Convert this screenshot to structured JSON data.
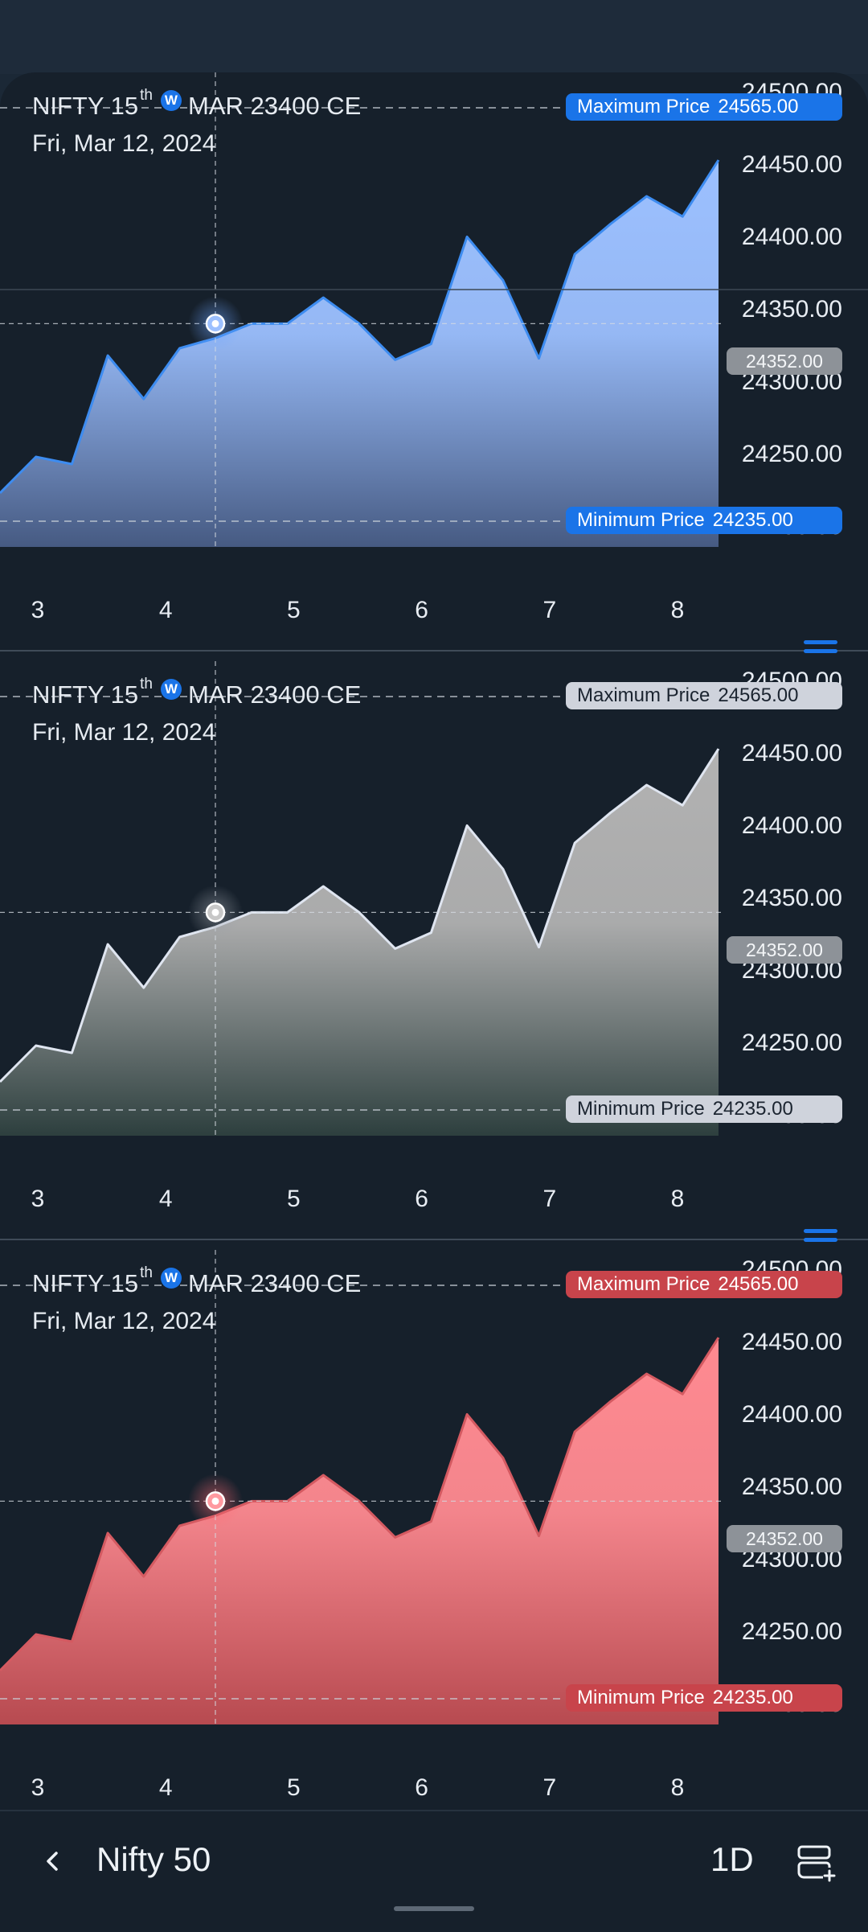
{
  "app": {
    "instrument_name": "NIFTY 15",
    "instrument_sup": "th",
    "weekly_badge": "W",
    "instrument_rest": "MAR 23400 CE",
    "date": "Fri, Mar 12, 2024"
  },
  "chart_data": [
    {
      "type": "area",
      "series": [
        {
          "values": [
            24235,
            24260,
            24255,
            24330,
            24300,
            24335,
            24342,
            24352,
            24352,
            24370,
            24352,
            24327,
            24338,
            24412,
            24382,
            24328,
            24400,
            24421,
            24440,
            24426,
            24465
          ]
        }
      ],
      "x_ticks": [
        "3",
        "4",
        "5",
        "6",
        "7",
        "8"
      ],
      "y_ticks": [
        "24500.00",
        "24450.00",
        "24400.00",
        "24350.00",
        "24300.00",
        "24250.00",
        "24200.00"
      ],
      "ylim": [
        24200,
        24500
      ],
      "max_label": "Maximum Price",
      "max_value": "24565.00",
      "min_label": "Minimum Price",
      "min_value": "24235.00",
      "current_value": "24352.00",
      "accent": "#1a74e8"
    },
    {
      "type": "area",
      "series": [
        {
          "values": [
            24235,
            24260,
            24255,
            24330,
            24300,
            24335,
            24342,
            24352,
            24352,
            24370,
            24352,
            24327,
            24338,
            24412,
            24382,
            24328,
            24400,
            24421,
            24440,
            24426,
            24465
          ]
        }
      ],
      "x_ticks": [
        "3",
        "4",
        "5",
        "6",
        "7",
        "8"
      ],
      "y_ticks": [
        "24500.00",
        "24450.00",
        "24400.00",
        "24350.00",
        "24300.00",
        "24250.00",
        "24200.00"
      ],
      "ylim": [
        24200,
        24500
      ],
      "max_label": "Maximum Price",
      "max_value": "24565.00",
      "min_label": "Minimum Price",
      "min_value": "24235.00",
      "current_value": "24352.00",
      "accent": "#cfd3dc"
    },
    {
      "type": "area",
      "series": [
        {
          "values": [
            24235,
            24260,
            24255,
            24330,
            24300,
            24335,
            24342,
            24352,
            24352,
            24370,
            24352,
            24327,
            24338,
            24412,
            24382,
            24328,
            24400,
            24421,
            24440,
            24426,
            24465
          ]
        }
      ],
      "x_ticks": [
        "3",
        "4",
        "5",
        "6",
        "7",
        "8"
      ],
      "y_ticks": [
        "24500.00",
        "24450.00",
        "24400.00",
        "24350.00",
        "24300.00",
        "24250.00",
        "24200.00"
      ],
      "ylim": [
        24200,
        24500
      ],
      "max_label": "Maximum Price",
      "max_value": "24565.00",
      "min_label": "Minimum Price",
      "min_value": "24235.00",
      "current_value": "24352.00",
      "accent": "#c8444b"
    }
  ],
  "bottom_bar": {
    "title": "Nifty 50",
    "interval": "1D",
    "back_icon": "chevron-left-icon",
    "layout_icon": "chart-layout-add-icon"
  }
}
